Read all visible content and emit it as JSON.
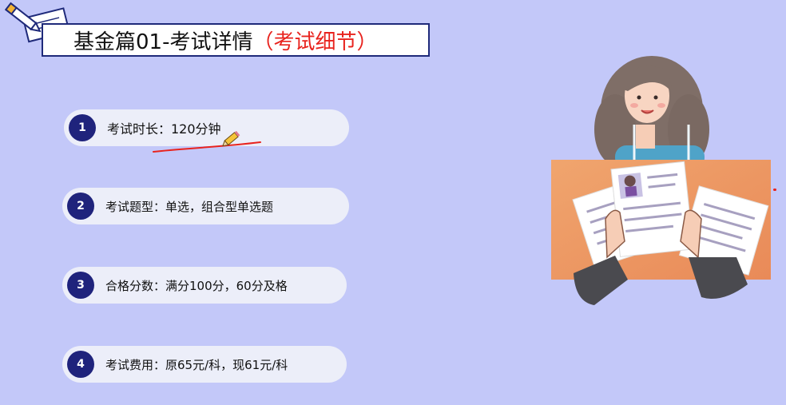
{
  "title": {
    "main": "基金篇01-考试详情",
    "sub": "（考试细节）"
  },
  "items": [
    {
      "number": "1",
      "text": "考试时长：120分钟"
    },
    {
      "number": "2",
      "text": "考试题型：单选，组合型单选题"
    },
    {
      "number": "3",
      "text": "合格分数：满分100分，60分及格"
    },
    {
      "number": "4",
      "text": "考试费用：原65元/科，现61元/科"
    }
  ],
  "colors": {
    "background": "#c3c8f9",
    "badge": "#1f237c",
    "accent_red": "#e8231e",
    "item_bg": "#eceef9"
  },
  "icons": {
    "title_decoration": "pen-and-paper-icon",
    "annotation": "pencil-icon",
    "illustration": "woman-holding-resume-illustration"
  }
}
